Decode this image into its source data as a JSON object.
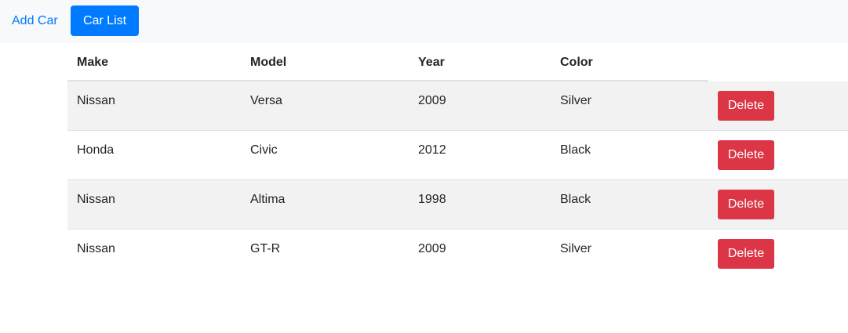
{
  "nav": {
    "add_car_label": "Add Car",
    "car_list_label": "Car List"
  },
  "table": {
    "headers": {
      "make": "Make",
      "model": "Model",
      "year": "Year",
      "color": "Color"
    },
    "rows": [
      {
        "make": "Nissan",
        "model": "Versa",
        "year": "2009",
        "color": "Silver",
        "action": "Delete"
      },
      {
        "make": "Honda",
        "model": "Civic",
        "year": "2012",
        "color": "Black",
        "action": "Delete"
      },
      {
        "make": "Nissan",
        "model": "Altima",
        "year": "1998",
        "color": "Black",
        "action": "Delete"
      },
      {
        "make": "Nissan",
        "model": "GT-R",
        "year": "2009",
        "color": "Silver",
        "action": "Delete"
      }
    ]
  },
  "colors": {
    "primary": "#007bff",
    "danger": "#dc3545",
    "navbar_bg": "#f8f9fa",
    "stripe": "#f2f2f2"
  }
}
